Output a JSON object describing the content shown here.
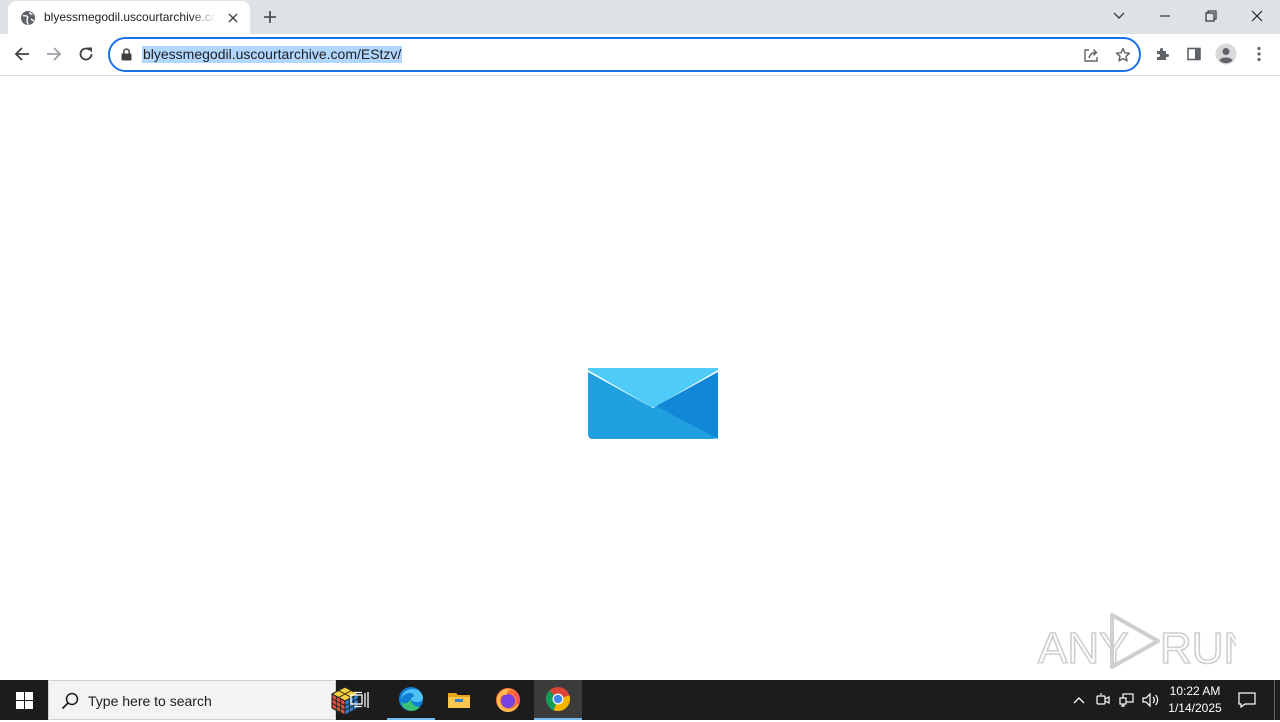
{
  "browser": {
    "tab": {
      "title": "blyessmegodil.uscourtarchive.com/EStzv/"
    },
    "omnibox": {
      "url": "blyessmegodil.uscourtarchive.com/EStzv/"
    }
  },
  "page": {
    "center_icon": "envelope-icon",
    "envelope_colors": {
      "top_flap": "#4fcbf8",
      "body": "#21a0e0",
      "right_fold": "#1187d8"
    }
  },
  "watermark": {
    "text_left": "ANY",
    "text_right": "RUN"
  },
  "taskbar": {
    "search_placeholder": "Type here to search",
    "apps": [
      "task-view-icon",
      "edge-icon",
      "file-explorer-icon",
      "firefox-icon",
      "chrome-icon"
    ],
    "clock": {
      "time": "10:22 AM",
      "date": "1/14/2025"
    }
  },
  "colors": {
    "accent": "#1a73e8",
    "selection": "#b2d7ff",
    "tabstrip": "#dee1e6",
    "taskbar": "#1c1c1c"
  }
}
